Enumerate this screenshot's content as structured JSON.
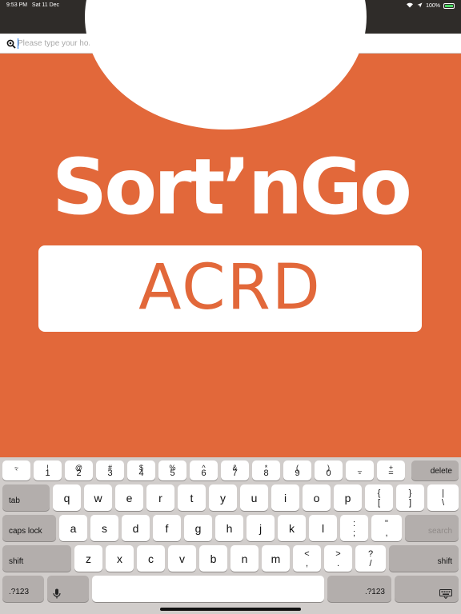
{
  "status_bar": {
    "time": "9:53 PM",
    "date": "Sat 11 Dec",
    "battery": "100%"
  },
  "nav": {
    "title": "Sort'nGo ACRD"
  },
  "search": {
    "placeholder": "Please type your home address:",
    "value": ""
  },
  "logo": {
    "brand": "Sort’nGo",
    "subtitle": "ACRD"
  },
  "colors": {
    "brand": "#e2683a",
    "nav_bg": "#2f2c29",
    "keyboard_bg": "#d1cdcb"
  },
  "keyboard": {
    "number_row": [
      {
        "top": "~",
        "bot": "`"
      },
      {
        "top": "!",
        "bot": "1"
      },
      {
        "top": "@",
        "bot": "2"
      },
      {
        "top": "#",
        "bot": "3"
      },
      {
        "top": "$",
        "bot": "4"
      },
      {
        "top": "%",
        "bot": "5"
      },
      {
        "top": "^",
        "bot": "6"
      },
      {
        "top": "&",
        "bot": "7"
      },
      {
        "top": "*",
        "bot": "8"
      },
      {
        "top": "(",
        "bot": "9"
      },
      {
        "top": ")",
        "bot": "0"
      },
      {
        "top": "_",
        "bot": "-"
      },
      {
        "top": "+",
        "bot": "="
      }
    ],
    "delete": "delete",
    "tab": "tab",
    "row_q": [
      "q",
      "w",
      "e",
      "r",
      "t",
      "y",
      "u",
      "i",
      "o",
      "p"
    ],
    "row_q_extra": [
      {
        "top": "{",
        "bot": "["
      },
      {
        "top": "}",
        "bot": "]"
      },
      {
        "top": "|",
        "bot": "\\"
      }
    ],
    "caps_lock": "caps lock",
    "row_a": [
      "a",
      "s",
      "d",
      "f",
      "g",
      "h",
      "j",
      "k",
      "l"
    ],
    "row_a_extra": [
      {
        "top": ":",
        "bot": ";"
      },
      {
        "top": "\"",
        "bot": ","
      }
    ],
    "search_key": "search",
    "shift": "shift",
    "row_z": [
      "z",
      "x",
      "c",
      "v",
      "b",
      "n",
      "m"
    ],
    "row_z_extra": [
      {
        "top": "<",
        "bot": ","
      },
      {
        "top": ">",
        "bot": "."
      },
      {
        "top": "?",
        "bot": "/"
      }
    ],
    "numbers_key": ".?123"
  }
}
